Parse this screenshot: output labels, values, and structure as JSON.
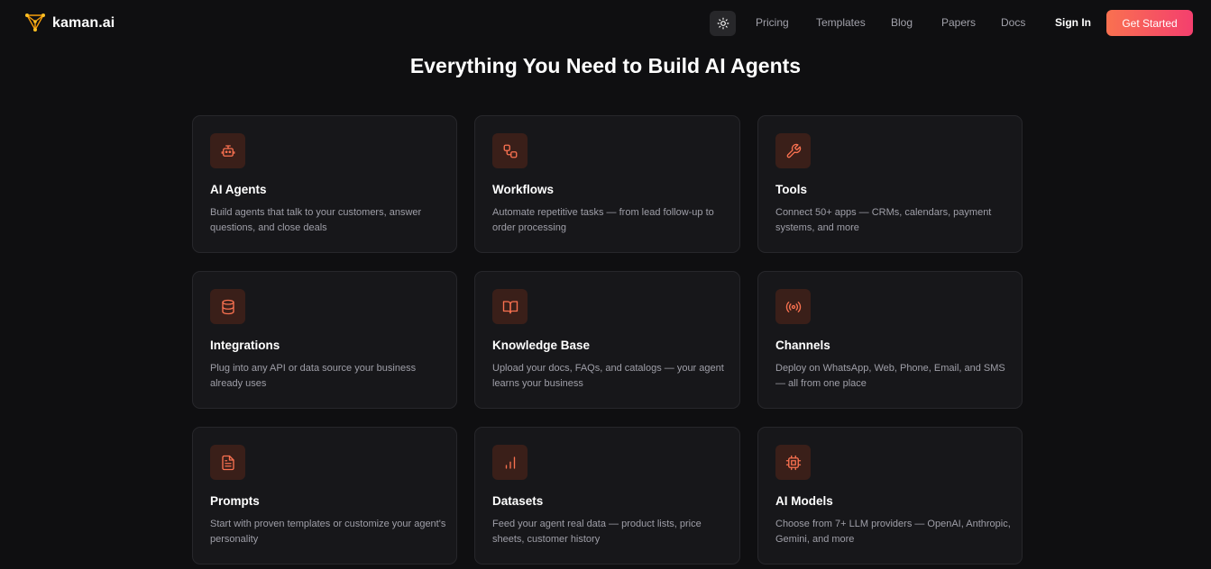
{
  "brand": {
    "name": "kaman.ai",
    "accent": "#f97150"
  },
  "nav": {
    "theme_toggle_icon": "sun-icon",
    "links": [
      "Pricing",
      "Templates",
      "Blog",
      "Papers",
      "Docs"
    ],
    "signin": "Sign In",
    "cta": "Get Started"
  },
  "headline": "Everything You Need to Build AI Agents",
  "features": [
    {
      "icon": "robot-icon",
      "title": "AI Agents",
      "description": "Build agents that talk to your customers, answer questions, and close deals"
    },
    {
      "icon": "workflow-icon",
      "title": "Workflows",
      "description": "Automate repetitive tasks — from lead follow-up to order processing"
    },
    {
      "icon": "wrench-icon",
      "title": "Tools",
      "description": "Connect 50+ apps — CRMs, calendars, payment systems, and more"
    },
    {
      "icon": "database-icon",
      "title": "Integrations",
      "description": "Plug into any API or data source your business already uses"
    },
    {
      "icon": "book-icon",
      "title": "Knowledge Base",
      "description": "Upload your docs, FAQs, and catalogs — your agent learns your business"
    },
    {
      "icon": "broadcast-icon",
      "title": "Channels",
      "description": "Deploy on WhatsApp, Web, Phone, Email, and SMS — all from one place"
    },
    {
      "icon": "document-icon",
      "title": "Prompts",
      "description": "Start with proven templates or customize your agent's personality"
    },
    {
      "icon": "bar-chart-icon",
      "title": "Datasets",
      "description": "Feed your agent real data — product lists, price sheets, customer history"
    },
    {
      "icon": "cpu-icon",
      "title": "AI Models",
      "description": "Choose from 7+ LLM providers — OpenAI, Anthropic, Gemini, and more"
    }
  ]
}
